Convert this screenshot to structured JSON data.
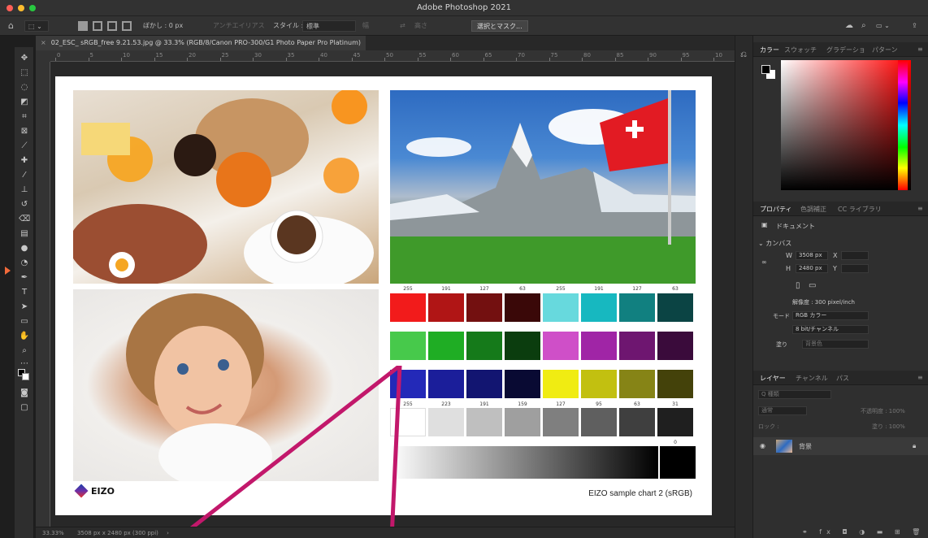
{
  "window": {
    "title": "Adobe Photoshop 2021"
  },
  "options_bar": {
    "feather_label": "ぼかし : 0 px",
    "antialias_label": "アンチエイリアス",
    "style_label": "スタイル :",
    "style_value": "標準",
    "width_label": "幅",
    "height_label": "高さ",
    "select_mask_button": "選択とマスク..."
  },
  "document": {
    "tab_title": "02_ESC_ sRGB_free 9.21.53.jpg @ 33.3% (RGB/8/Canon PRO-300/G1 Photo Paper Pro Platinum)",
    "caption": "EIZO sample chart 2  (sRGB)",
    "logo_text": "EIZO"
  },
  "ruler_ticks": [
    "0",
    "5",
    "10",
    "15",
    "20",
    "25",
    "30",
    "35",
    "40",
    "45",
    "50",
    "55",
    "60",
    "65",
    "70",
    "75",
    "80",
    "85",
    "90",
    "95",
    "10"
  ],
  "chart_labels": {
    "row1": [
      "255",
      "191",
      "127",
      "63",
      "255",
      "191",
      "127",
      "63"
    ],
    "gray": [
      "255",
      "223",
      "191",
      "159",
      "127",
      "95",
      "63",
      "31"
    ],
    "black": "0"
  },
  "swatches": {
    "row1": [
      "#f21b1b",
      "#b01515",
      "#731010",
      "#3a0808",
      "#67d9dd",
      "#17b8c0",
      "#118080",
      "#0b4444"
    ],
    "row2": [
      "#47c94b",
      "#1fad24",
      "#157a1a",
      "#0b3d0e",
      "#cf4fc8",
      "#a025a6",
      "#6e1670",
      "#3a0b3b"
    ],
    "row3": [
      "#2329b8",
      "#1b1e9a",
      "#121571",
      "#090a33",
      "#f0ec12",
      "#c2c010",
      "#868416",
      "#44420a"
    ],
    "gray": [
      "#ffffff",
      "#dfdfdf",
      "#bfbfbf",
      "#9f9f9f",
      "#7f7f7f",
      "#5f5f5f",
      "#3f3f3f",
      "#1f1f1f"
    ]
  },
  "status_bar": {
    "zoom": "33.33%",
    "doc_size": "3508 px x 2480 px (300 ppi)"
  },
  "color_panel": {
    "tabs": [
      "カラー",
      "スウォッチ",
      "グラデーショ",
      "パターン"
    ]
  },
  "properties_panel": {
    "tabs": [
      "プロパティ",
      "色調補正",
      "CC ライブラリ"
    ],
    "document_label": "ドキュメント",
    "canvas_label": "カンバス",
    "w_label": "W",
    "w_value": "3508 px",
    "x_label": "X",
    "h_label": "H",
    "h_value": "2480 px",
    "y_label": "Y",
    "resolution": "解像度 : 300 pixel/inch",
    "mode_label": "モード",
    "mode_value": "RGB カラー",
    "bit_value": "8 bit/チャンネル",
    "fill_label": "塗り",
    "fill_value": "背景色"
  },
  "layers_panel": {
    "tabs": [
      "レイヤー",
      "チャンネル",
      "パス"
    ],
    "search_placeholder": "Q 種類",
    "blend_mode": "通常",
    "opacity_label": "不透明度 : 100%",
    "lock_label": "ロック :",
    "fill_label": "塗り : 100%",
    "layer_name": "背景"
  },
  "colors": {
    "callout": "#c2186b",
    "accent": "#f36a3a"
  }
}
